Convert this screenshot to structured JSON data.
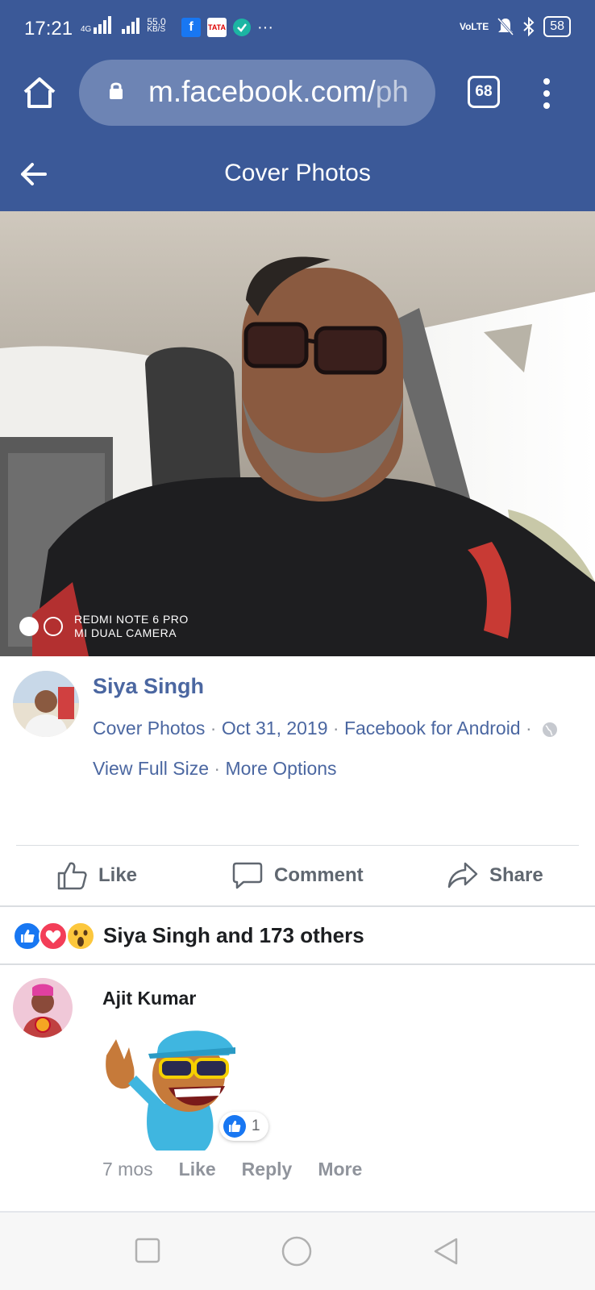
{
  "status": {
    "time": "17:21",
    "network": "4G",
    "speed_value": "55.0",
    "speed_unit": "KB/S",
    "volte": "VoLTE",
    "battery": "58",
    "icons": [
      "signal-icon",
      "facebook-notification-icon",
      "tata-sky-notification-icon",
      "verified-check-icon",
      "more-dots-icon",
      "mute-bell-icon",
      "bluetooth-icon",
      "battery-icon"
    ]
  },
  "browser": {
    "url_main": "m.facebook.com/",
    "url_rest": "ph",
    "tab_count": "68"
  },
  "header": {
    "title": "Cover Photos"
  },
  "photo": {
    "watermark_line1": "REDMI NOTE 6 PRO",
    "watermark_line2": "MI DUAL CAMERA"
  },
  "post": {
    "author": "Siya Singh",
    "album": "Cover Photos",
    "sep": "·",
    "date": "Oct 31, 2019",
    "source": "Facebook for Android",
    "view_full_size": "View Full Size",
    "more_options": "More Options"
  },
  "actions": {
    "like": "Like",
    "comment": "Comment",
    "share": "Share"
  },
  "reactions": {
    "summary": "Siya Singh and 173 others",
    "types": [
      "like",
      "love",
      "wow"
    ]
  },
  "comment": {
    "author": "Ajit Kumar",
    "reaction_count": "1",
    "time": "7 mos",
    "like": "Like",
    "reply": "Reply",
    "more": "More"
  },
  "colors": {
    "brand": "#3b5998",
    "link": "#4b67a1",
    "muted": "#90949c"
  }
}
